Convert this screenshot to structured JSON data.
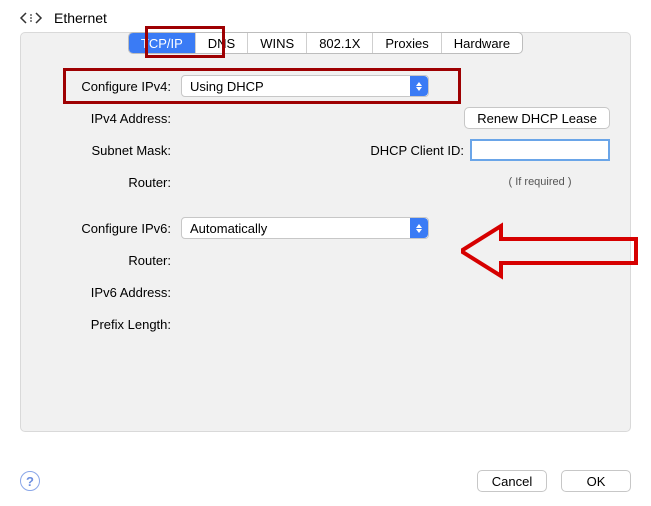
{
  "title": "Ethernet",
  "tabs": [
    "TCP/IP",
    "DNS",
    "WINS",
    "802.1X",
    "Proxies",
    "Hardware"
  ],
  "active_tab": "TCP/IP",
  "labels": {
    "configure_ipv4": "Configure IPv4:",
    "ipv4_address": "IPv4 Address:",
    "subnet_mask": "Subnet Mask:",
    "router": "Router:",
    "configure_ipv6": "Configure IPv6:",
    "router6": "Router:",
    "ipv6_address": "IPv6 Address:",
    "prefix_length": "Prefix Length:",
    "dhcp_client_id": "DHCP Client ID:",
    "hint": "( If required )"
  },
  "values": {
    "configure_ipv4": "Using DHCP",
    "configure_ipv6": "Automatically",
    "dhcp_client_id": ""
  },
  "buttons": {
    "renew_dhcp": "Renew DHCP Lease",
    "cancel": "Cancel",
    "ok": "OK"
  },
  "annotations": {
    "highlight_tab": true,
    "highlight_ipv4_row": true,
    "arrow_to_ipv6": true
  }
}
